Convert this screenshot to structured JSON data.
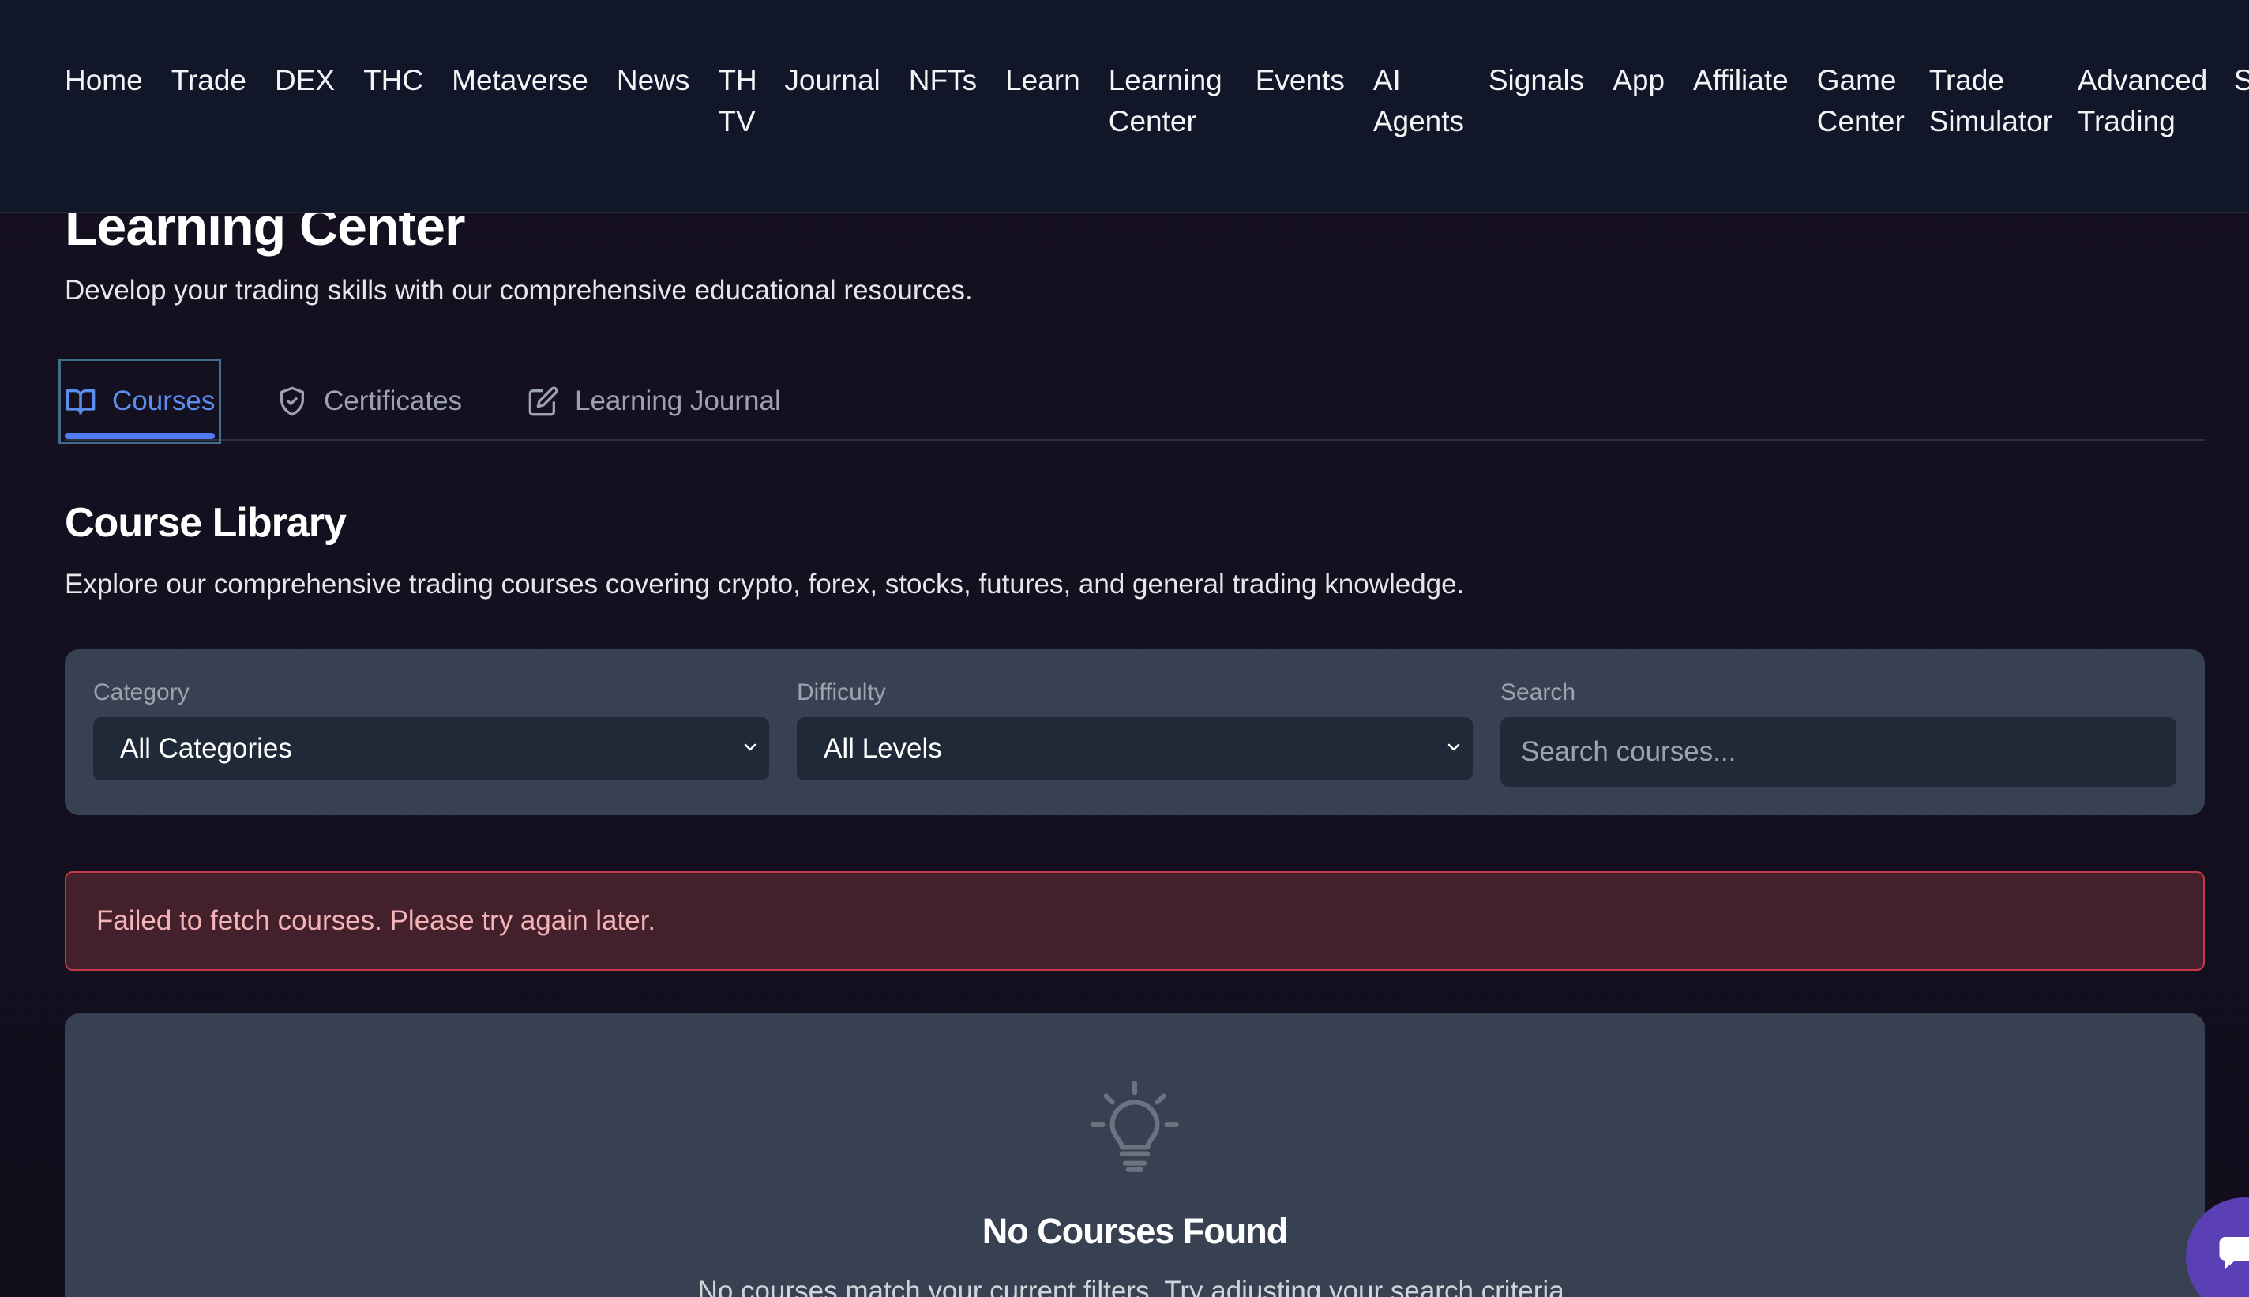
{
  "nav": {
    "items": [
      "Home",
      "Trade",
      "DEX",
      "THC",
      "Metaverse",
      "News",
      "TH TV",
      "Journal",
      "NFTs",
      "Learn",
      "Learning Center",
      "Events",
      "AI Agents",
      "Signals",
      "App",
      "Affiliate",
      "Game Center",
      "Trade Simulator",
      "Advanced Trading",
      "Shop"
    ]
  },
  "header": {
    "title": "Learning Center",
    "subtitle": "Develop your trading skills with our comprehensive educational resources."
  },
  "tabs": [
    {
      "label": "Courses",
      "icon": "book-open-icon",
      "active": true
    },
    {
      "label": "Certificates",
      "icon": "shield-check-icon",
      "active": false
    },
    {
      "label": "Learning Journal",
      "icon": "edit-icon",
      "active": false
    }
  ],
  "library": {
    "title": "Course Library",
    "subtitle": "Explore our comprehensive trading courses covering crypto, forex, stocks, futures, and general trading knowledge."
  },
  "filters": {
    "category_label": "Category",
    "category_value": "All Categories",
    "difficulty_label": "Difficulty",
    "difficulty_value": "All Levels",
    "search_label": "Search",
    "search_placeholder": "Search courses..."
  },
  "error": {
    "message": "Failed to fetch courses. Please try again later."
  },
  "empty": {
    "title": "No Courses Found",
    "subtitle": "No courses match your current filters. Try adjusting your search criteria."
  },
  "colors": {
    "accent": "#5b8def",
    "error_border": "#c53a48",
    "panel": "#374151",
    "nav_bg": "#111729"
  }
}
